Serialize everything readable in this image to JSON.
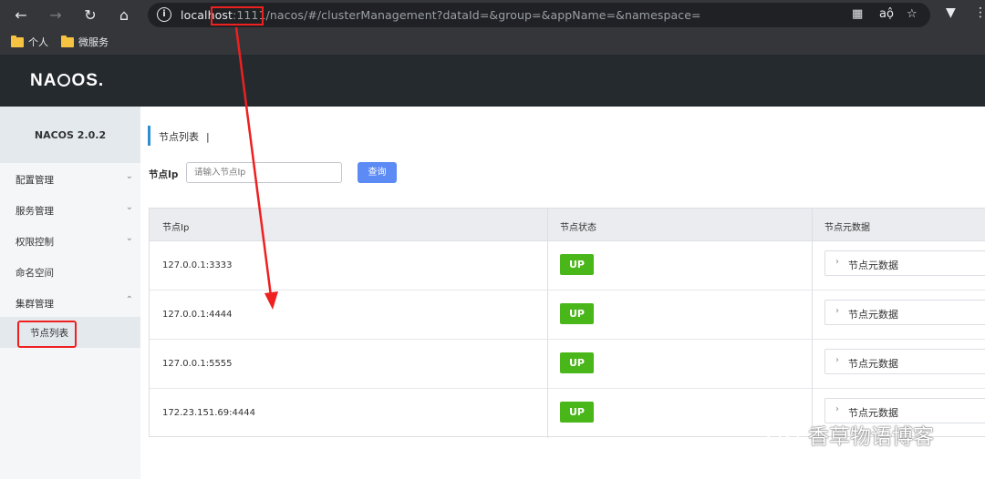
{
  "browser": {
    "url_host": "localhost",
    "url_port": ":1111",
    "url_path": "/nacos/#/clusterManagement?dataId=&group=&appName=&namespace=",
    "bookmarks": [
      "个人",
      "微服务"
    ]
  },
  "header": {
    "logo": "NACOS."
  },
  "sidebar": {
    "version": "NACOS 2.0.2",
    "items": [
      {
        "label": "配置管理",
        "chevron": "⌄"
      },
      {
        "label": "服务管理",
        "chevron": "⌄"
      },
      {
        "label": "权限控制",
        "chevron": "⌄"
      },
      {
        "label": "命名空间",
        "chevron": ""
      },
      {
        "label": "集群管理",
        "chevron": "⌃"
      }
    ],
    "sub_item": "节点列表"
  },
  "main": {
    "title": "节点列表",
    "title_bar": "|",
    "search_label": "节点Ip",
    "search_placeholder": "请输入节点Ip",
    "search_button": "查询",
    "columns": [
      "节点Ip",
      "节点状态",
      "节点元数据"
    ],
    "rows": [
      {
        "ip": "127.0.0.1:3333",
        "status": "UP",
        "meta": "节点元数据"
      },
      {
        "ip": "127.0.0.1:4444",
        "status": "UP",
        "meta": "节点元数据"
      },
      {
        "ip": "127.0.0.1:5555",
        "status": "UP",
        "meta": "节点元数据"
      },
      {
        "ip": "172.23.151.69:4444",
        "status": "UP",
        "meta": "节点元数据"
      }
    ]
  },
  "watermark": "香草物语博客",
  "colors": {
    "accent": "#5c8bf6",
    "up": "#49b719",
    "header": "#252a2f",
    "annotation": "#ee2020"
  }
}
